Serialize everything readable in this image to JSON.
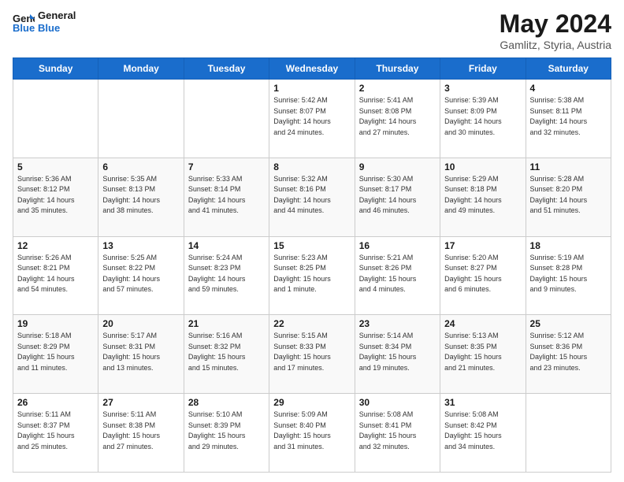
{
  "header": {
    "logo_line1": "General",
    "logo_line2": "Blue",
    "main_title": "May 2024",
    "subtitle": "Gamlitz, Styria, Austria"
  },
  "days_of_week": [
    "Sunday",
    "Monday",
    "Tuesday",
    "Wednesday",
    "Thursday",
    "Friday",
    "Saturday"
  ],
  "weeks": [
    [
      {
        "day": "",
        "info": ""
      },
      {
        "day": "",
        "info": ""
      },
      {
        "day": "",
        "info": ""
      },
      {
        "day": "1",
        "info": "Sunrise: 5:42 AM\nSunset: 8:07 PM\nDaylight: 14 hours\nand 24 minutes."
      },
      {
        "day": "2",
        "info": "Sunrise: 5:41 AM\nSunset: 8:08 PM\nDaylight: 14 hours\nand 27 minutes."
      },
      {
        "day": "3",
        "info": "Sunrise: 5:39 AM\nSunset: 8:09 PM\nDaylight: 14 hours\nand 30 minutes."
      },
      {
        "day": "4",
        "info": "Sunrise: 5:38 AM\nSunset: 8:11 PM\nDaylight: 14 hours\nand 32 minutes."
      }
    ],
    [
      {
        "day": "5",
        "info": "Sunrise: 5:36 AM\nSunset: 8:12 PM\nDaylight: 14 hours\nand 35 minutes."
      },
      {
        "day": "6",
        "info": "Sunrise: 5:35 AM\nSunset: 8:13 PM\nDaylight: 14 hours\nand 38 minutes."
      },
      {
        "day": "7",
        "info": "Sunrise: 5:33 AM\nSunset: 8:14 PM\nDaylight: 14 hours\nand 41 minutes."
      },
      {
        "day": "8",
        "info": "Sunrise: 5:32 AM\nSunset: 8:16 PM\nDaylight: 14 hours\nand 44 minutes."
      },
      {
        "day": "9",
        "info": "Sunrise: 5:30 AM\nSunset: 8:17 PM\nDaylight: 14 hours\nand 46 minutes."
      },
      {
        "day": "10",
        "info": "Sunrise: 5:29 AM\nSunset: 8:18 PM\nDaylight: 14 hours\nand 49 minutes."
      },
      {
        "day": "11",
        "info": "Sunrise: 5:28 AM\nSunset: 8:20 PM\nDaylight: 14 hours\nand 51 minutes."
      }
    ],
    [
      {
        "day": "12",
        "info": "Sunrise: 5:26 AM\nSunset: 8:21 PM\nDaylight: 14 hours\nand 54 minutes."
      },
      {
        "day": "13",
        "info": "Sunrise: 5:25 AM\nSunset: 8:22 PM\nDaylight: 14 hours\nand 57 minutes."
      },
      {
        "day": "14",
        "info": "Sunrise: 5:24 AM\nSunset: 8:23 PM\nDaylight: 14 hours\nand 59 minutes."
      },
      {
        "day": "15",
        "info": "Sunrise: 5:23 AM\nSunset: 8:25 PM\nDaylight: 15 hours\nand 1 minute."
      },
      {
        "day": "16",
        "info": "Sunrise: 5:21 AM\nSunset: 8:26 PM\nDaylight: 15 hours\nand 4 minutes."
      },
      {
        "day": "17",
        "info": "Sunrise: 5:20 AM\nSunset: 8:27 PM\nDaylight: 15 hours\nand 6 minutes."
      },
      {
        "day": "18",
        "info": "Sunrise: 5:19 AM\nSunset: 8:28 PM\nDaylight: 15 hours\nand 9 minutes."
      }
    ],
    [
      {
        "day": "19",
        "info": "Sunrise: 5:18 AM\nSunset: 8:29 PM\nDaylight: 15 hours\nand 11 minutes."
      },
      {
        "day": "20",
        "info": "Sunrise: 5:17 AM\nSunset: 8:31 PM\nDaylight: 15 hours\nand 13 minutes."
      },
      {
        "day": "21",
        "info": "Sunrise: 5:16 AM\nSunset: 8:32 PM\nDaylight: 15 hours\nand 15 minutes."
      },
      {
        "day": "22",
        "info": "Sunrise: 5:15 AM\nSunset: 8:33 PM\nDaylight: 15 hours\nand 17 minutes."
      },
      {
        "day": "23",
        "info": "Sunrise: 5:14 AM\nSunset: 8:34 PM\nDaylight: 15 hours\nand 19 minutes."
      },
      {
        "day": "24",
        "info": "Sunrise: 5:13 AM\nSunset: 8:35 PM\nDaylight: 15 hours\nand 21 minutes."
      },
      {
        "day": "25",
        "info": "Sunrise: 5:12 AM\nSunset: 8:36 PM\nDaylight: 15 hours\nand 23 minutes."
      }
    ],
    [
      {
        "day": "26",
        "info": "Sunrise: 5:11 AM\nSunset: 8:37 PM\nDaylight: 15 hours\nand 25 minutes."
      },
      {
        "day": "27",
        "info": "Sunrise: 5:11 AM\nSunset: 8:38 PM\nDaylight: 15 hours\nand 27 minutes."
      },
      {
        "day": "28",
        "info": "Sunrise: 5:10 AM\nSunset: 8:39 PM\nDaylight: 15 hours\nand 29 minutes."
      },
      {
        "day": "29",
        "info": "Sunrise: 5:09 AM\nSunset: 8:40 PM\nDaylight: 15 hours\nand 31 minutes."
      },
      {
        "day": "30",
        "info": "Sunrise: 5:08 AM\nSunset: 8:41 PM\nDaylight: 15 hours\nand 32 minutes."
      },
      {
        "day": "31",
        "info": "Sunrise: 5:08 AM\nSunset: 8:42 PM\nDaylight: 15 hours\nand 34 minutes."
      },
      {
        "day": "",
        "info": ""
      }
    ]
  ]
}
